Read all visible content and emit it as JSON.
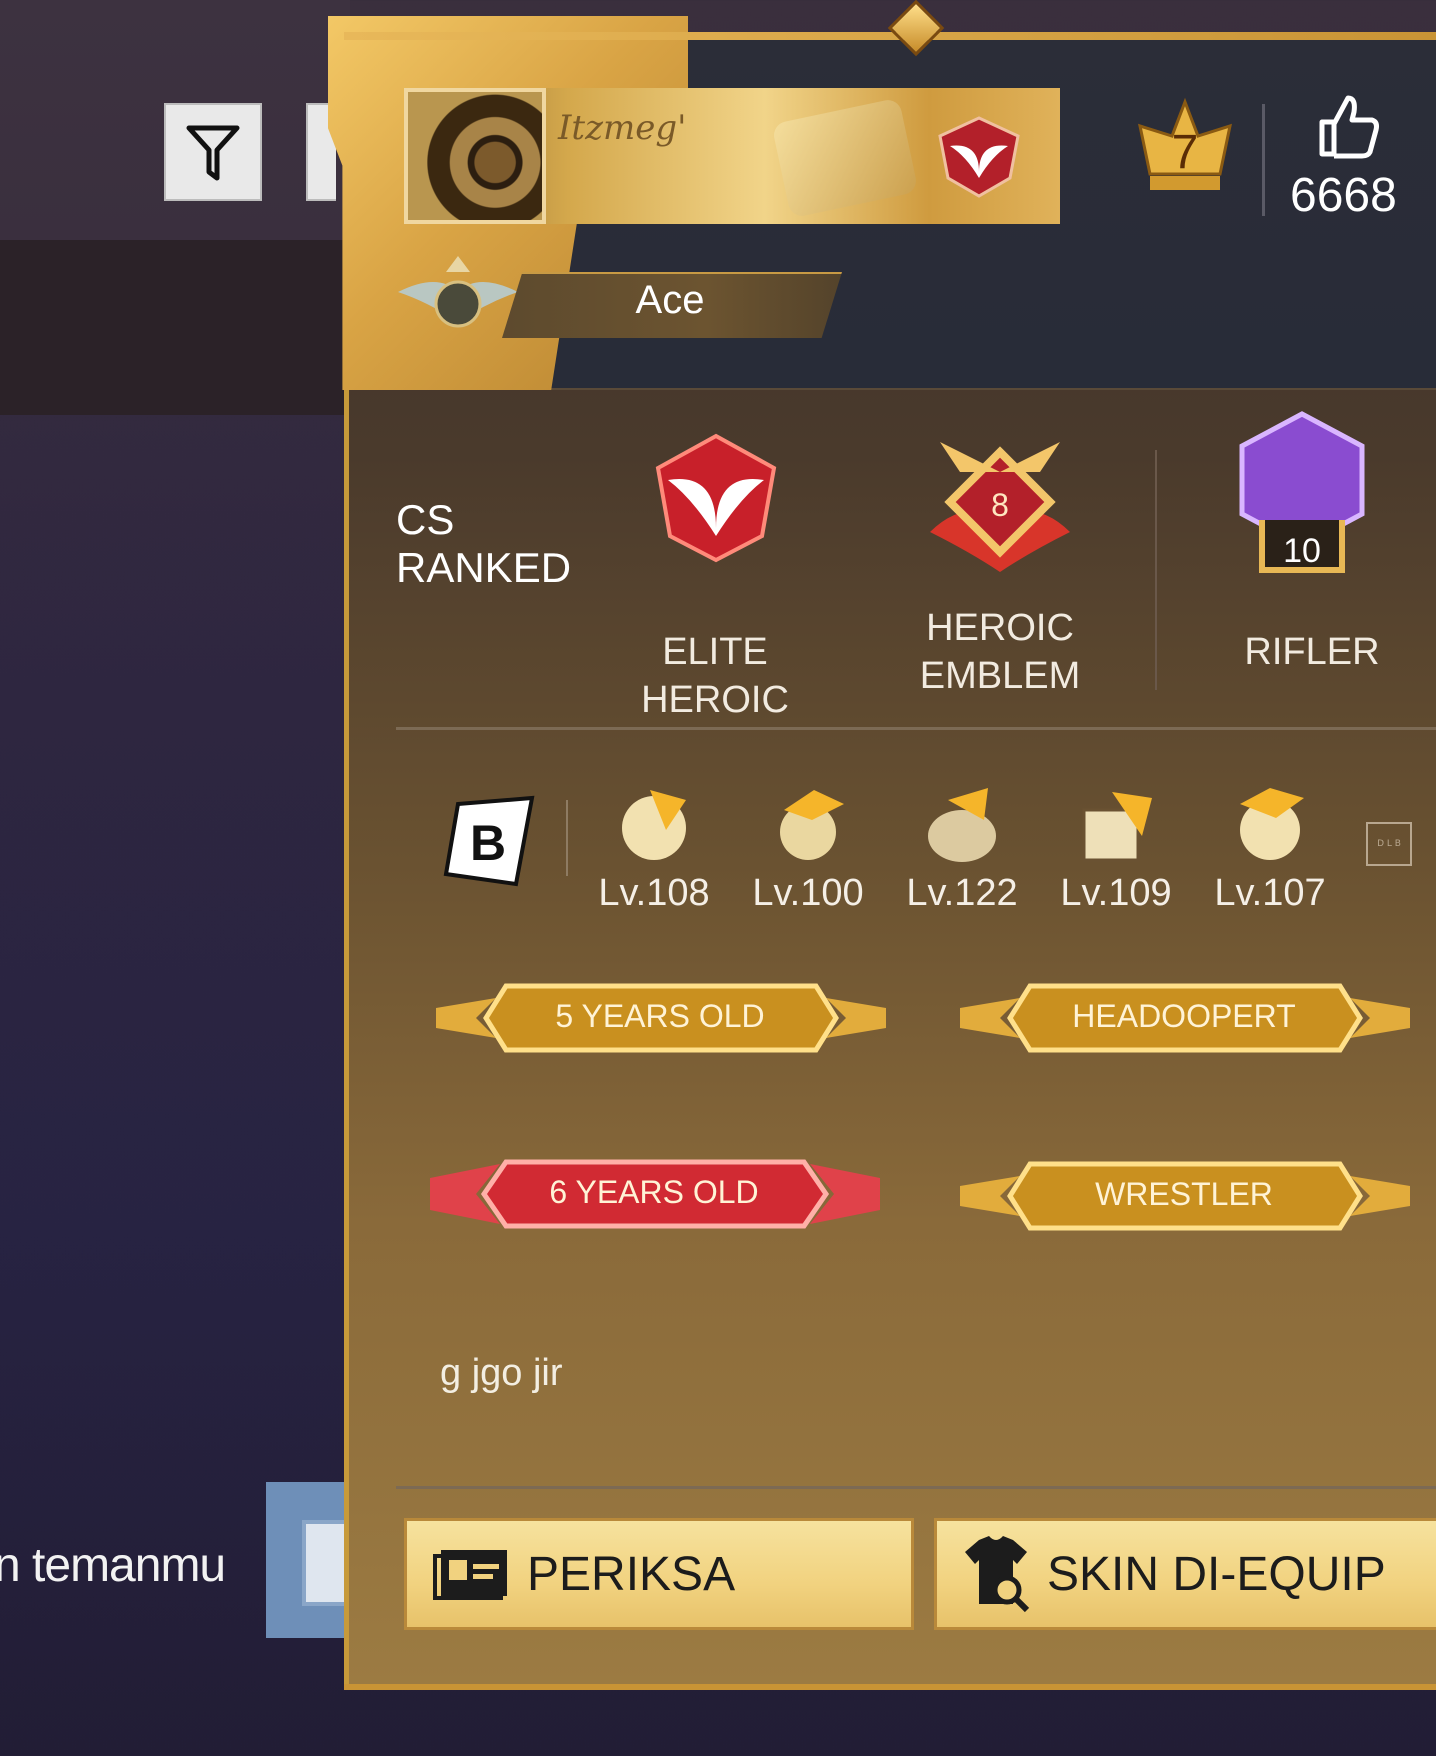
{
  "background": {
    "bottom_text": "n temanmu"
  },
  "profile": {
    "nickname": "Itzmeg'",
    "title": "Ace",
    "level_badge": "7",
    "likes": "6668"
  },
  "ranked": {
    "label": "CS\nRANKED",
    "items": [
      {
        "label": "ELITE HEROIC"
      },
      {
        "label": "HEROIC\nEMBLEM",
        "badge": "8"
      },
      {
        "label": "RIFLER",
        "badge": "10"
      }
    ]
  },
  "pets": {
    "items": [
      {
        "level": "Lv.108"
      },
      {
        "level": "Lv.100"
      },
      {
        "level": "Lv.122"
      },
      {
        "level": "Lv.109"
      },
      {
        "level": "Lv.107"
      }
    ]
  },
  "badges": [
    {
      "label": "5 YEARS OLD",
      "color": "#e0a93a"
    },
    {
      "label": "HEADOOPERT",
      "color": "#e0a93a"
    },
    {
      "label": "6 YEARS OLD",
      "color": "#d8333a"
    },
    {
      "label": "WRESTLER",
      "color": "#e0a93a"
    }
  ],
  "signature": "g jgo jir",
  "actions": {
    "inspect_label": "PERIKSA",
    "skins_label": "SKIN DI-EQUIP"
  },
  "colors": {
    "gold": "#c99435",
    "panel_dark": "#282c38",
    "button": "#f1d27f"
  }
}
